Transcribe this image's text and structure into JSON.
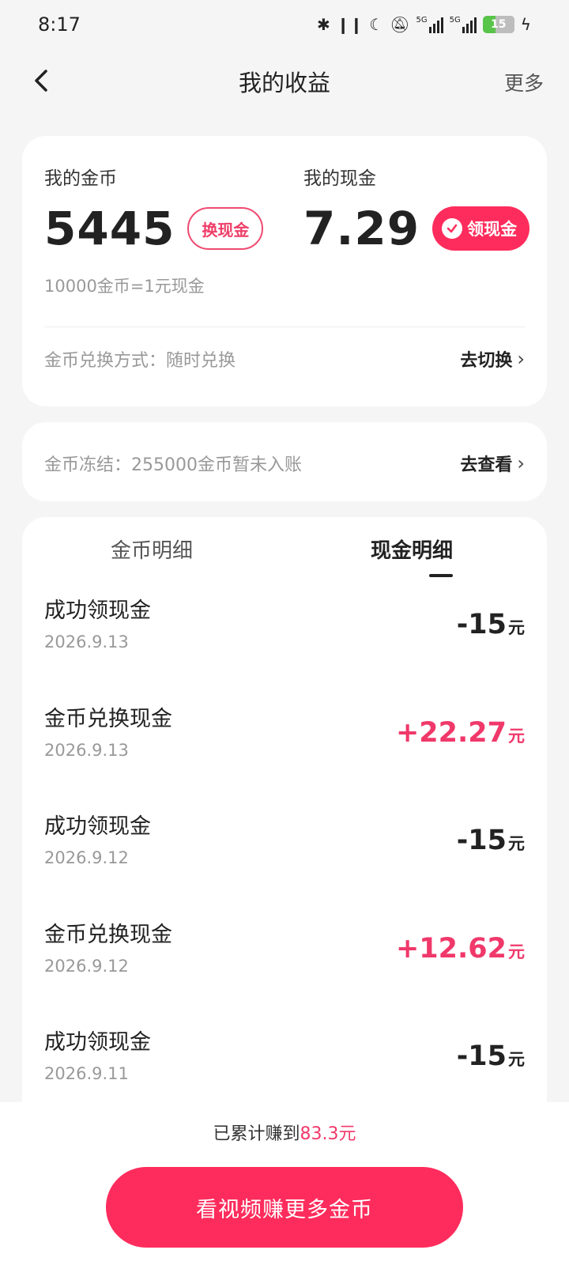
{
  "status_bar": {
    "time": "8:17",
    "battery": "15",
    "signal_label_1": "5G",
    "signal_label_2": "5G"
  },
  "nav": {
    "title": "我的收益",
    "more": "更多"
  },
  "balance": {
    "coin_label": "我的金币",
    "coin_value": "5445",
    "exchange_button": "换现金",
    "cash_label": "我的现金",
    "cash_value": "7.29",
    "withdraw_button": "领现金",
    "rate_text": "10000金币=1元现金",
    "exchange_method": "金币兑换方式：随时兑换",
    "switch_action": "去切换"
  },
  "frozen": {
    "text": "金币冻结：255000金币暂未入账",
    "action": "去查看"
  },
  "tabs": {
    "coin_detail": "金币明细",
    "cash_detail": "现金明细"
  },
  "transactions": [
    {
      "title": "成功领现金",
      "date": "2026.9.13",
      "amount": "-15",
      "unit": "元",
      "type": "negative"
    },
    {
      "title": "金币兑换现金",
      "date": "2026.9.13",
      "amount": "+22.27",
      "unit": "元",
      "type": "positive"
    },
    {
      "title": "成功领现金",
      "date": "2026.9.12",
      "amount": "-15",
      "unit": "元",
      "type": "negative"
    },
    {
      "title": "金币兑换现金",
      "date": "2026.9.12",
      "amount": "+12.62",
      "unit": "元",
      "type": "positive"
    },
    {
      "title": "成功领现金",
      "date": "2026.9.11",
      "amount": "-15",
      "unit": "元",
      "type": "negative"
    }
  ],
  "footer": {
    "earned_prefix": "已累计赚到",
    "earned_amount": "83.3元",
    "cta": "看视频赚更多金币"
  },
  "colors": {
    "accent": "#fe2c5c",
    "positive_amount": "#f0386a",
    "background": "#f5f5f5"
  }
}
